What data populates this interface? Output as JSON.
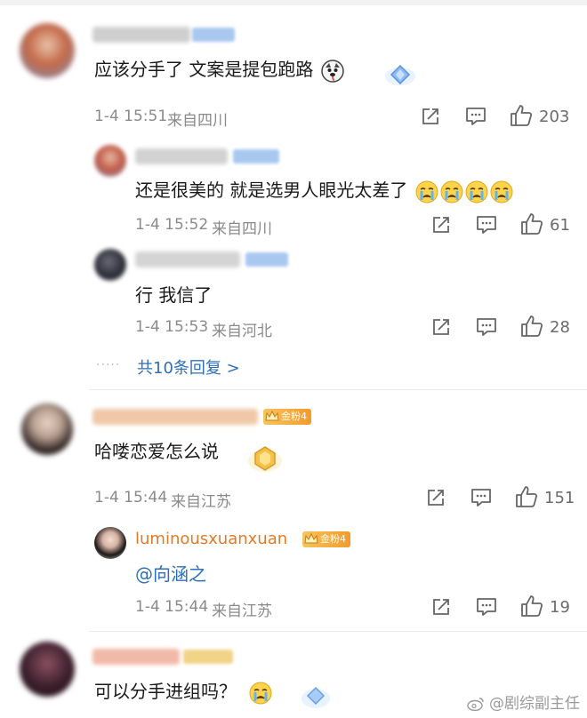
{
  "comments": [
    {
      "text": "应该分手了 文案是提包跑路",
      "time": "1-4 15:51",
      "location": "来自四川",
      "likes": "203",
      "replies": [
        {
          "text": "还是很美的 就是选男人眼光太差了",
          "time": "1-4 15:52",
          "location": "来自四川",
          "likes": "61"
        },
        {
          "text": "行 我信了",
          "time": "1-4 15:53",
          "location": "来自河北",
          "likes": "28"
        }
      ],
      "more_replies": "共10条回复 >"
    },
    {
      "fan_badge": "金粉4",
      "text": "哈喽恋爱怎么说",
      "time": "1-4 15:44",
      "location": "来自江苏",
      "likes": "151",
      "replies": [
        {
          "username": "luminousxuanxuan",
          "fan_badge": "金粉4",
          "text": "@向涵之",
          "time": "1-4 15:44",
          "location": "来自江苏",
          "likes": "19"
        }
      ]
    },
    {
      "text": "可以分手进组吗？"
    }
  ],
  "watermark": "@剧综副主任",
  "colors": {
    "link": "#2f6fb5",
    "username": "#e07b2a",
    "meta": "#8a8a8a",
    "divider": "#ececec"
  },
  "icons": [
    "repost-icon",
    "comment-icon",
    "thumbs-up-icon",
    "crying-emoji-icon",
    "husky-emoji-icon",
    "diamond-sticker-icon",
    "crown-icon",
    "weibo-logo-icon"
  ]
}
